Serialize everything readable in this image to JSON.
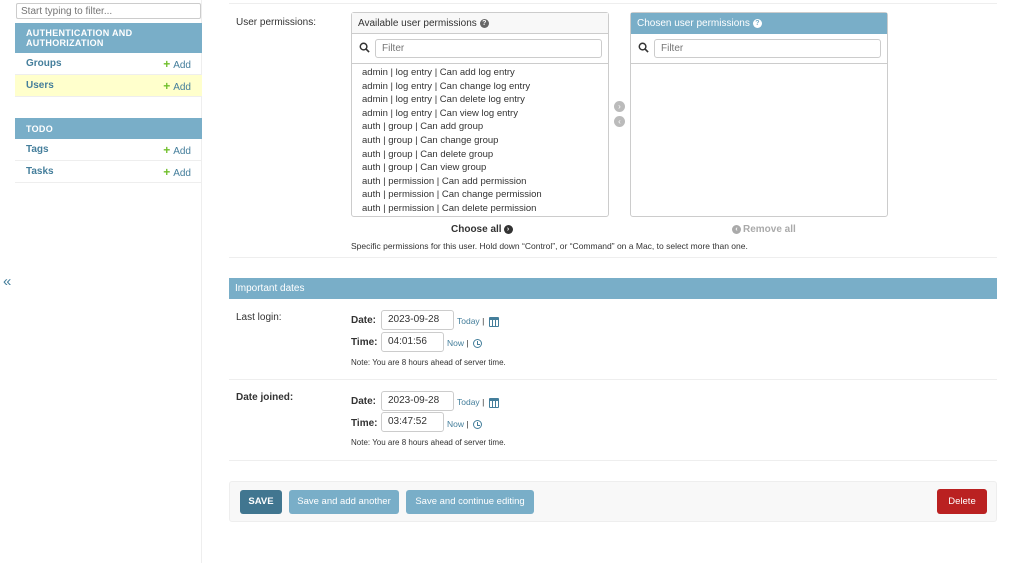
{
  "nav_toggle": "«",
  "sidebar": {
    "filter_placeholder": "Start typing to filter...",
    "modules": [
      {
        "title": "AUTHENTICATION AND AUTHORIZATION",
        "rows": [
          {
            "name": "Groups",
            "add": "Add"
          },
          {
            "name": "Users",
            "add": "Add",
            "current": true
          }
        ]
      },
      {
        "title": "TODO",
        "rows": [
          {
            "name": "Tags",
            "add": "Add"
          },
          {
            "name": "Tasks",
            "add": "Add"
          }
        ]
      }
    ]
  },
  "permissions": {
    "label": "User permissions:",
    "available_title": "Available user permissions",
    "chosen_title": "Chosen user permissions",
    "filter_placeholder": "Filter",
    "options": [
      "admin | log entry | Can add log entry",
      "admin | log entry | Can change log entry",
      "admin | log entry | Can delete log entry",
      "admin | log entry | Can view log entry",
      "auth | group | Can add group",
      "auth | group | Can change group",
      "auth | group | Can delete group",
      "auth | group | Can view group",
      "auth | permission | Can add permission",
      "auth | permission | Can change permission",
      "auth | permission | Can delete permission"
    ],
    "choose_all": "Choose all",
    "remove_all": "Remove all",
    "help_text": "Specific permissions for this user. Hold down “Control”, or “Command” on a Mac, to select more than one."
  },
  "important_dates": {
    "heading": "Important dates",
    "last_login": {
      "label": "Last login:",
      "date_label": "Date:",
      "date_value": "2023-09-28",
      "today": "Today",
      "time_label": "Time:",
      "time_value": "04:01:56",
      "now": "Now",
      "note": "Note: You are 8 hours ahead of server time."
    },
    "date_joined": {
      "label": "Date joined:",
      "date_label": "Date:",
      "date_value": "2023-09-28",
      "today": "Today",
      "time_label": "Time:",
      "time_value": "03:47:52",
      "now": "Now",
      "note": "Note: You are 8 hours ahead of server time."
    }
  },
  "submit": {
    "save": "SAVE",
    "save_add_another": "Save and add another",
    "save_continue": "Save and continue editing",
    "delete": "Delete"
  },
  "colors": {
    "module_header": "#79aec8",
    "link": "#447e9b",
    "add_plus": "#70bf2b",
    "current_row": "#ffffcc",
    "save_button": "#417690",
    "delete_button": "#ba2121"
  }
}
